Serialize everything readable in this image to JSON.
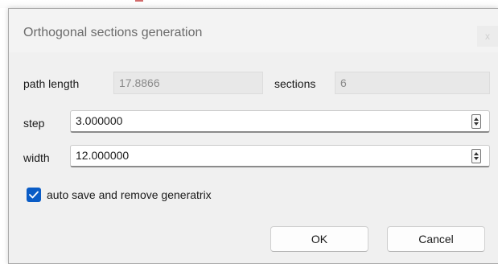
{
  "dialog": {
    "title": "Orthogonal sections generation",
    "close_label": "x"
  },
  "fields": {
    "path_length_label": "path length",
    "path_length_value": "17.8866",
    "sections_label": "sections",
    "sections_value": "6",
    "step_label": "step",
    "step_value": "3.000000",
    "width_label": "width",
    "width_value": "12.000000"
  },
  "options": {
    "auto_save_label": "auto save and remove generatrix",
    "auto_save_checked": true
  },
  "buttons": {
    "ok_label": "OK",
    "cancel_label": "Cancel"
  },
  "colors": {
    "checkbox_accent": "#0a5cc6",
    "dialog_background": "#f0f0f0"
  }
}
